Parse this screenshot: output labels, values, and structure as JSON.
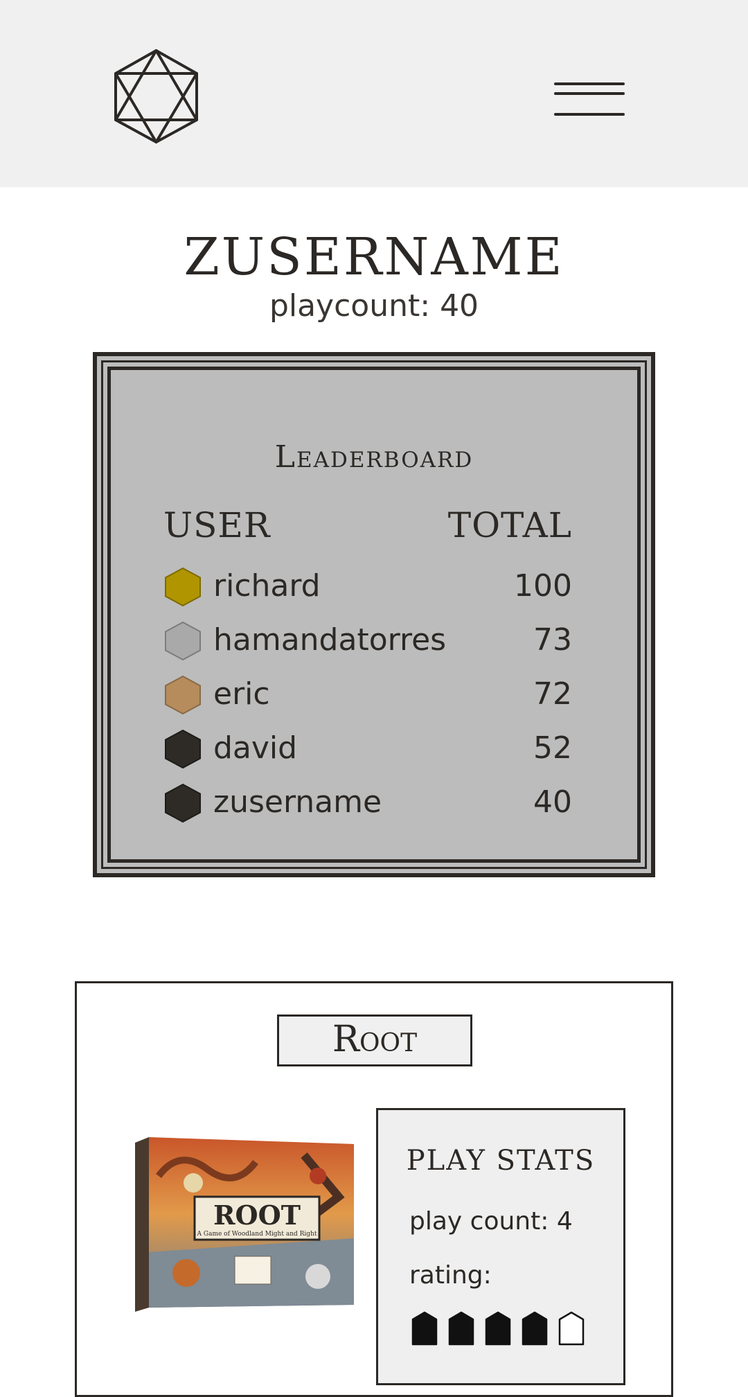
{
  "header": {
    "logo_icon": "d20-dice-icon",
    "menu_icon": "hamburger-menu-icon"
  },
  "profile": {
    "username": "ZUSERNAME",
    "playcount_label": "playcount:",
    "playcount_value": "40"
  },
  "leaderboard": {
    "title": "Leaderboard",
    "col_user": "USER",
    "col_total": "TOTAL",
    "rows": [
      {
        "name": "richard",
        "total": "100",
        "badge_color": "#b09500",
        "badge_stroke": "#7d6a00"
      },
      {
        "name": "hamandatorres",
        "total": "73",
        "badge_color": "#a9a9a9",
        "badge_stroke": "#7c7c7c"
      },
      {
        "name": "eric",
        "total": "72",
        "badge_color": "#b68c5c",
        "badge_stroke": "#8a6a45"
      },
      {
        "name": "david",
        "total": "52",
        "badge_color": "#2e2a26",
        "badge_stroke": "#1e1b18"
      },
      {
        "name": "zusername",
        "total": "40",
        "badge_color": "#2e2a26",
        "badge_stroke": "#1e1b18"
      }
    ]
  },
  "game": {
    "title": "Root",
    "box_art_title": "ROOT",
    "box_art_subtitle": "A Game of Woodland Might and Right",
    "stats_title": "PLAY STATS",
    "play_count_label": "play count:",
    "play_count_value": "4",
    "rating_label": "rating:",
    "rating_value": 4,
    "rating_max": 5
  }
}
